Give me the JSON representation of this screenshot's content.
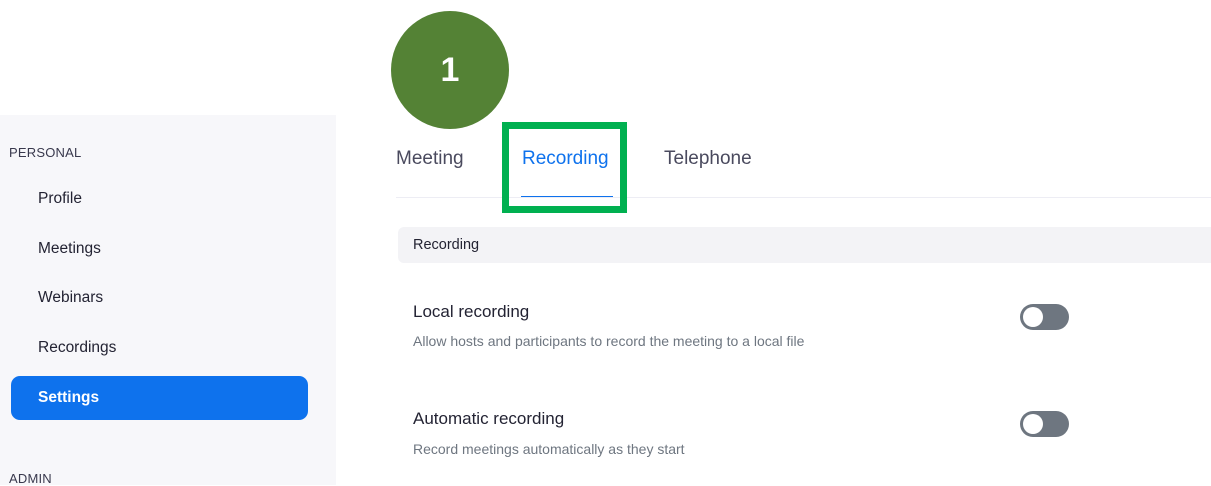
{
  "sidebar": {
    "personal_label": "PERSONAL",
    "items": [
      {
        "label": "Profile"
      },
      {
        "label": "Meetings"
      },
      {
        "label": "Webinars"
      },
      {
        "label": "Recordings"
      },
      {
        "label": "Settings",
        "active": true
      }
    ],
    "admin_label": "ADMIN"
  },
  "annotation": {
    "step_number": "1",
    "badge_color": "#548235",
    "highlight_color": "#00b050"
  },
  "tabs": [
    {
      "label": "Meeting"
    },
    {
      "label": "Recording",
      "active": true
    },
    {
      "label": "Telephone"
    }
  ],
  "section": {
    "title": "Recording"
  },
  "settings": [
    {
      "title": "Local recording",
      "description": "Allow hosts and participants to record the meeting to a local file",
      "enabled": false
    },
    {
      "title": "Automatic recording",
      "description": "Record meetings automatically as they start",
      "enabled": false
    }
  ],
  "colors": {
    "accent": "#0e72ed",
    "toggle_off": "#6e7680",
    "sidebar_bg": "#f7f7fa"
  }
}
